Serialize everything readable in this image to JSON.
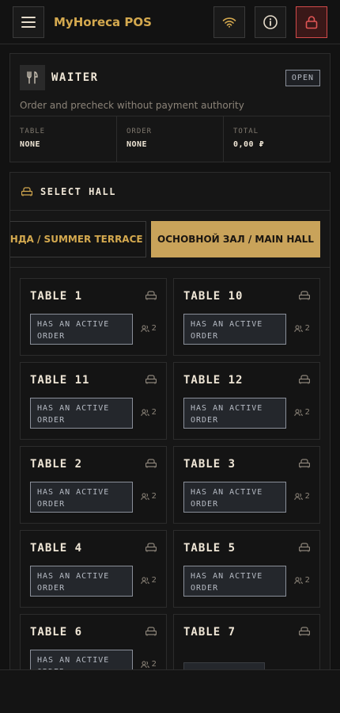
{
  "app": {
    "title": "MyHoreca POS"
  },
  "role": {
    "name": "WAITER",
    "status": "OPEN",
    "description": "Order and precheck without payment authority",
    "stats": [
      {
        "label": "TABLE",
        "value": "NONE"
      },
      {
        "label": "ORDER",
        "value": "NONE"
      },
      {
        "label": "TOTAL",
        "value": "0,00 ₽"
      }
    ]
  },
  "hall": {
    "title": "SELECT HALL",
    "tabs": [
      {
        "label": "ВЕРАНДА / SUMMER TERRACE",
        "active": false
      },
      {
        "label": "ОСНОВНОЙ ЗАЛ / MAIN HALL",
        "active": true
      }
    ]
  },
  "tables": [
    {
      "name": "TABLE 1",
      "status": "HAS AN ACTIVE ORDER",
      "guests": "2"
    },
    {
      "name": "TABLE 10",
      "status": "HAS AN ACTIVE ORDER",
      "guests": "2"
    },
    {
      "name": "TABLE 11",
      "status": "HAS AN ACTIVE ORDER",
      "guests": "2"
    },
    {
      "name": "TABLE 12",
      "status": "HAS AN ACTIVE ORDER",
      "guests": "2"
    },
    {
      "name": "TABLE 2",
      "status": "HAS AN ACTIVE ORDER",
      "guests": "2"
    },
    {
      "name": "TABLE 3",
      "status": "HAS AN ACTIVE ORDER",
      "guests": "2"
    },
    {
      "name": "TABLE 4",
      "status": "HAS AN ACTIVE ORDER",
      "guests": "2"
    },
    {
      "name": "TABLE 5",
      "status": "HAS AN ACTIVE ORDER",
      "guests": "2"
    },
    {
      "name": "TABLE 6",
      "status": "HAS AN ACTIVE ORDER",
      "guests": "2"
    },
    {
      "name": "TABLE 7",
      "status": "",
      "guests": ""
    }
  ],
  "colors": {
    "accent": "#d4a94f",
    "tab_active_bg": "#c9a35a",
    "danger": "#d24a4a",
    "background": "#121212"
  },
  "icons": {
    "menu": "menu-icon",
    "wifi": "wifi-icon",
    "info": "info-icon",
    "lock": "lock-icon",
    "role": "fork-knife-icon",
    "hall": "armchair-icon",
    "guests": "users-icon"
  }
}
